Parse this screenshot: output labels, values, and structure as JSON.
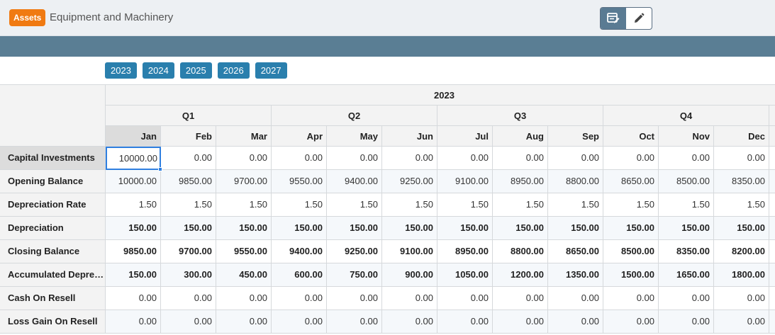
{
  "header": {
    "badge": "Assets",
    "title": "Equipment and Machinery",
    "view_buttons": [
      {
        "icon": "table-edit-icon",
        "active": true
      },
      {
        "icon": "pencil-icon",
        "active": false
      }
    ]
  },
  "year_tabs": [
    "2023",
    "2024",
    "2025",
    "2026",
    "2027"
  ],
  "table": {
    "year": "2023",
    "quarters": [
      "Q1",
      "Q2",
      "Q3",
      "Q4"
    ],
    "months": [
      "Jan",
      "Feb",
      "Mar",
      "Apr",
      "May",
      "Jun",
      "Jul",
      "Aug",
      "Sep",
      "Oct",
      "Nov",
      "Dec"
    ],
    "rows": [
      {
        "label": "Capital Investments",
        "bold": false,
        "values": [
          "10000.00",
          "0.00",
          "0.00",
          "0.00",
          "0.00",
          "0.00",
          "0.00",
          "0.00",
          "0.00",
          "0.00",
          "0.00",
          "0.00"
        ]
      },
      {
        "label": "Opening Balance",
        "bold": false,
        "values": [
          "10000.00",
          "9850.00",
          "9700.00",
          "9550.00",
          "9400.00",
          "9250.00",
          "9100.00",
          "8950.00",
          "8800.00",
          "8650.00",
          "8500.00",
          "8350.00"
        ]
      },
      {
        "label": "Depreciation Rate",
        "bold": false,
        "values": [
          "1.50",
          "1.50",
          "1.50",
          "1.50",
          "1.50",
          "1.50",
          "1.50",
          "1.50",
          "1.50",
          "1.50",
          "1.50",
          "1.50"
        ]
      },
      {
        "label": "Depreciation",
        "bold": true,
        "values": [
          "150.00",
          "150.00",
          "150.00",
          "150.00",
          "150.00",
          "150.00",
          "150.00",
          "150.00",
          "150.00",
          "150.00",
          "150.00",
          "150.00"
        ]
      },
      {
        "label": "Closing Balance",
        "bold": true,
        "values": [
          "9850.00",
          "9700.00",
          "9550.00",
          "9400.00",
          "9250.00",
          "9100.00",
          "8950.00",
          "8800.00",
          "8650.00",
          "8500.00",
          "8350.00",
          "8200.00"
        ]
      },
      {
        "label": "Accumulated Depre…",
        "bold": true,
        "values": [
          "150.00",
          "300.00",
          "450.00",
          "600.00",
          "750.00",
          "900.00",
          "1050.00",
          "1200.00",
          "1350.00",
          "1500.00",
          "1650.00",
          "1800.00"
        ]
      },
      {
        "label": "Cash On Resell",
        "bold": false,
        "values": [
          "0.00",
          "0.00",
          "0.00",
          "0.00",
          "0.00",
          "0.00",
          "0.00",
          "0.00",
          "0.00",
          "0.00",
          "0.00",
          "0.00"
        ]
      },
      {
        "label": "Loss Gain On Resell",
        "bold": false,
        "values": [
          "0.00",
          "0.00",
          "0.00",
          "0.00",
          "0.00",
          "0.00",
          "0.00",
          "0.00",
          "0.00",
          "0.00",
          "0.00",
          "0.00"
        ]
      }
    ]
  }
}
